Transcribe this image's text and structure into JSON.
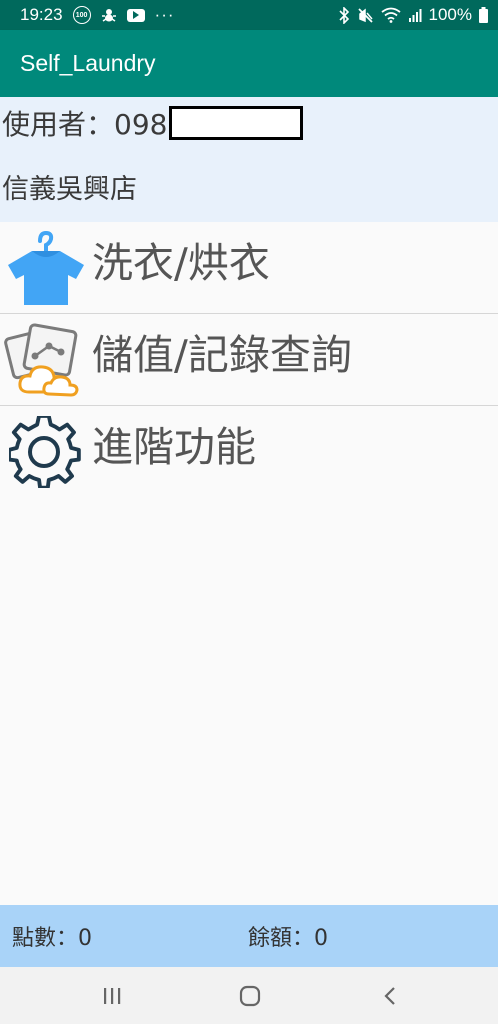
{
  "status_bar": {
    "time": "19:23",
    "notif_badge": "100",
    "overflow": "···",
    "battery": "100%",
    "icons": [
      "notification-100-icon",
      "spider-icon",
      "youtube-icon",
      "bluetooth-icon",
      "mute-icon",
      "wifi-icon",
      "signal-icon",
      "battery-icon"
    ]
  },
  "app_bar": {
    "title": "Self_Laundry"
  },
  "user_info": {
    "user_label": "使用者：098",
    "store": "信義吳興店"
  },
  "menu": [
    {
      "label": "洗衣/烘衣",
      "icon": "tshirt-hanger-icon"
    },
    {
      "label": "儲值/記錄查詢",
      "icon": "cards-cloud-icon"
    },
    {
      "label": "進階功能",
      "icon": "gear-icon"
    }
  ],
  "footer": {
    "points": "點數：0",
    "balance": "餘額：0"
  },
  "nav_bar": {
    "buttons": [
      "recent-apps-icon",
      "home-icon",
      "back-icon"
    ]
  },
  "colors": {
    "status_bar": "#00695c",
    "app_bar": "#00897b",
    "user_panel": "#e8f1fb",
    "footer": "#a9d3f8",
    "shirt": "#42a5f5",
    "gear": "#1f3a4d",
    "cloud": "#f0a020"
  }
}
